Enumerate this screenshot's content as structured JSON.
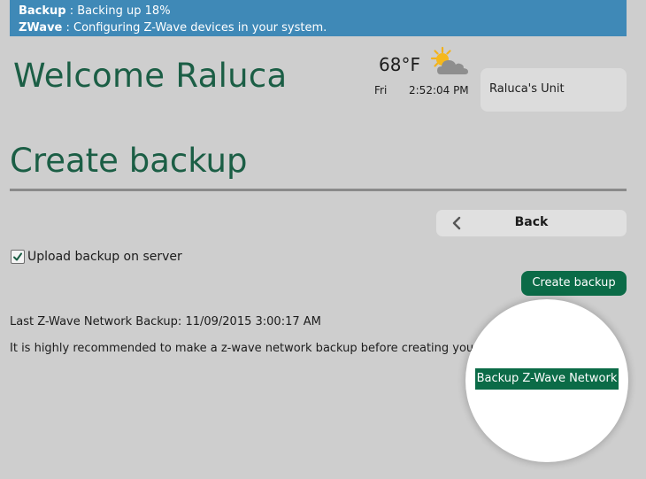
{
  "status": {
    "backup_key": "Backup",
    "backup_value": " : Backing up 18%",
    "zwave_key": "ZWave",
    "zwave_value": " : Configuring Z-Wave devices in your system."
  },
  "header": {
    "welcome": "Welcome Raluca",
    "temperature": "68°F",
    "weather_icon": "partly-cloudy-icon",
    "day": "Fri",
    "time": "2:52:04 PM",
    "unit_name": "Raluca's Unit"
  },
  "page": {
    "title": "Create backup",
    "back_label": "Back",
    "upload_label": "Upload backup on server",
    "upload_checked": true,
    "create_label": "Create backup",
    "last_backup": "Last Z-Wave Network Backup: 11/09/2015 3:00:17 AM",
    "recommend_text": "It is highly recommended to make a z-wave network backup before creating your controller full backup.",
    "zwave_backup_label": "Backup Z-Wave Network"
  },
  "colors": {
    "status_bar": "#3f89b7",
    "accent_green": "#0b6b47",
    "title_green": "#1b5e45",
    "background": "#cecece"
  }
}
